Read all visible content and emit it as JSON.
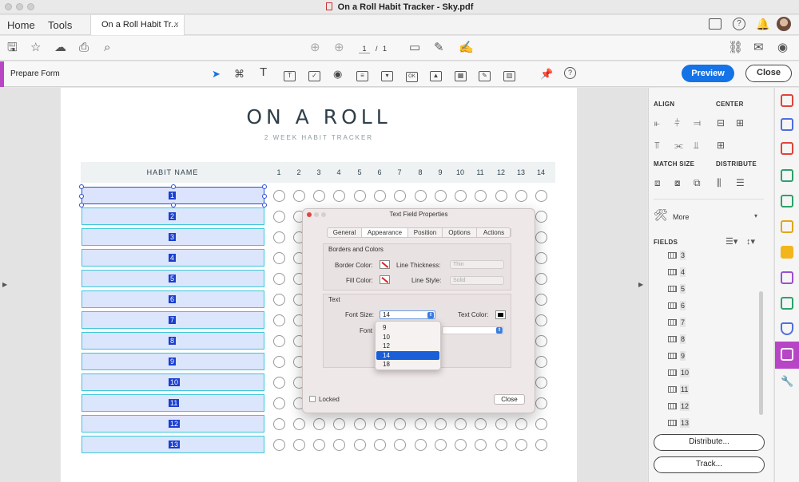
{
  "window": {
    "title": "On a Roll Habit Tracker - Sky.pdf"
  },
  "nav": {
    "home": "Home",
    "tools": "Tools",
    "doc_tab": "On a Roll Habit Tr...",
    "doc_tab_close": "×"
  },
  "toolbar": {
    "page_current": "1",
    "page_sep": "/",
    "page_total": "1"
  },
  "prepare": {
    "label": "Prepare Form",
    "preview": "Preview",
    "close": "Close"
  },
  "page": {
    "title": "ON A ROLL",
    "subtitle": "2 WEEK HABIT TRACKER",
    "habit_header": "HABIT NAME",
    "days": [
      "1",
      "2",
      "3",
      "4",
      "5",
      "6",
      "7",
      "8",
      "9",
      "10",
      "11",
      "12",
      "13",
      "14"
    ],
    "fields": [
      "1",
      "2",
      "3",
      "4",
      "5",
      "6",
      "7",
      "8",
      "9",
      "10",
      "11",
      "12",
      "13"
    ]
  },
  "dialog": {
    "title": "Text Field Properties",
    "tabs": [
      "General",
      "Appearance",
      "Position",
      "Options",
      "Actions"
    ],
    "active_tab": "Appearance",
    "borders_section": "Borders and Colors",
    "border_color": "Border Color:",
    "line_thickness": "Line Thickness:",
    "line_thickness_value": "Thin",
    "fill_color": "Fill Color:",
    "line_style": "Line Style:",
    "line_style_value": "Solid",
    "text_section": "Text",
    "font_size": "Font Size:",
    "font_size_value": "14",
    "text_color": "Text Color:",
    "font": "Font",
    "font_size_options": [
      "9",
      "10",
      "12",
      "14",
      "18"
    ],
    "font_size_selected": "14",
    "locked": "Locked",
    "close": "Close"
  },
  "right_panel": {
    "align": "ALIGN",
    "center": "CENTER",
    "match_size": "MATCH SIZE",
    "distribute": "DISTRIBUTE",
    "more": "More",
    "fields": "FIELDS",
    "field_list": [
      "3",
      "4",
      "5",
      "6",
      "7",
      "8",
      "9",
      "10",
      "11",
      "12",
      "13"
    ],
    "distribute_btn": "Distribute...",
    "track_btn": "Track..."
  },
  "colors": {
    "accent": "#1473e6",
    "prepare_accent": "#b845c6",
    "field_fill": "#dbe5fb",
    "field_border": "#3dc7d9"
  }
}
